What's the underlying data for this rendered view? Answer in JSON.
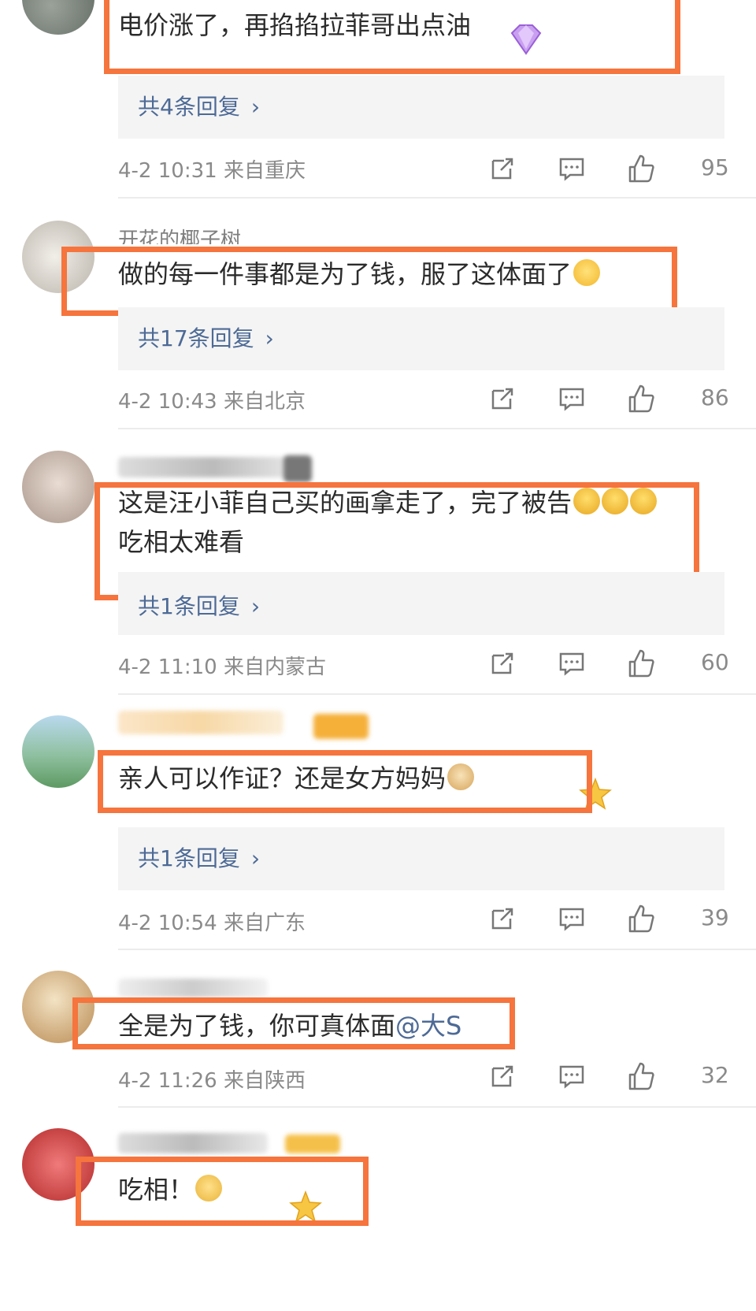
{
  "comments": [
    {
      "username": "",
      "text": "电价涨了，再掐掐拉菲哥出点油",
      "reply_label": "共4条回复",
      "date": "4-2 10:31",
      "location": "来自重庆",
      "likes": "95"
    },
    {
      "username": "开花的椰子树",
      "text": "做的每一件事都是为了钱，服了这体面了",
      "reply_label": "共17条回复",
      "date": "4-2 10:43",
      "location": "来自北京",
      "likes": "86"
    },
    {
      "username": "",
      "text": "这是汪小菲自己买的画拿走了，完了被告",
      "text2": "吃相太难看",
      "reply_label": "共1条回复",
      "date": "4-2 11:10",
      "location": "来自内蒙古",
      "likes": "60"
    },
    {
      "username": "",
      "text": "亲人可以作证？还是女方妈妈",
      "reply_label": "共1条回复",
      "date": "4-2 10:54",
      "location": "来自广东",
      "likes": "39"
    },
    {
      "username": "",
      "text": "全是为了钱，你可真体面",
      "mention": "@大S",
      "date": "4-2 11:26",
      "location": "来自陕西",
      "likes": "32"
    },
    {
      "username": "",
      "text": "吃相！"
    }
  ],
  "icons": {
    "share": "share-icon",
    "comment": "comment-icon",
    "like": "thumbs-up-icon"
  },
  "colors": {
    "highlight": "#f6743d",
    "link": "#4d6a96",
    "meta": "#8a8a8a"
  }
}
